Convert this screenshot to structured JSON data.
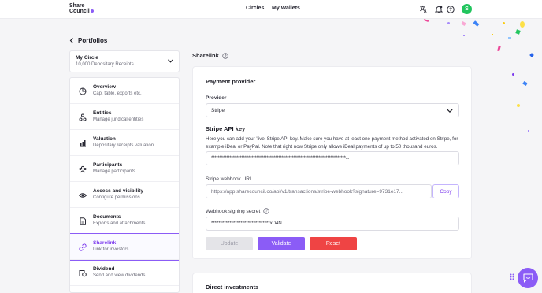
{
  "header": {
    "logo_line1": "Share",
    "logo_line2": "Council",
    "nav": [
      "Circles",
      "My Wallets"
    ],
    "avatar_initial": "S",
    "accent": "#8b5cf6"
  },
  "back_label": "Portfolios",
  "circle": {
    "title": "My Circle",
    "subtitle": "10,000 Depositary Receipts"
  },
  "menu": [
    {
      "title": "Overview",
      "subtitle": "Cap. table, exports etc.",
      "icon": "pie-chart-icon"
    },
    {
      "title": "Entities",
      "subtitle": "Manage juridical entities",
      "icon": "entities-icon"
    },
    {
      "title": "Valuation",
      "subtitle": "Depositary receipts valuation",
      "icon": "bar-chart-icon"
    },
    {
      "title": "Participants",
      "subtitle": "Manage participants",
      "icon": "participants-icon"
    },
    {
      "title": "Access and visibility",
      "subtitle": "Configure permissions",
      "icon": "eye-icon"
    },
    {
      "title": "Documents",
      "subtitle": "Exports and attachments",
      "icon": "document-icon"
    },
    {
      "title": "Sharelink",
      "subtitle": "Link for investors",
      "icon": "link-icon",
      "active": true
    },
    {
      "title": "Dividend",
      "subtitle": "Send and view dividends",
      "icon": "dividend-icon"
    }
  ],
  "section_title": "Sharelink",
  "payment": {
    "title": "Payment provider",
    "provider_label": "Provider",
    "provider_value": "Stripe",
    "api_title": "Stripe API key",
    "api_desc": "Here you can add your 'live' Stripe API key. Make sure you have at least one payment method activated on Stripe, for example iDeal or PayPal. Note that right now Stripe only allows iDeal payments of up to 50 thousand euros.",
    "api_value": "********************************************************************************...",
    "webhook_label": "Stripe webhook URL",
    "webhook_value": "https://app.sharecouncil.co/api/v1/transactions/stripe-webhook?signature=9731e17...",
    "copy_label": "Copy",
    "secret_label": "Webhook signing secret",
    "secret_value": "********************************xD4N",
    "update_label": "Update",
    "validate_label": "Validate",
    "reset_label": "Reset"
  },
  "direct_title": "Direct investments"
}
